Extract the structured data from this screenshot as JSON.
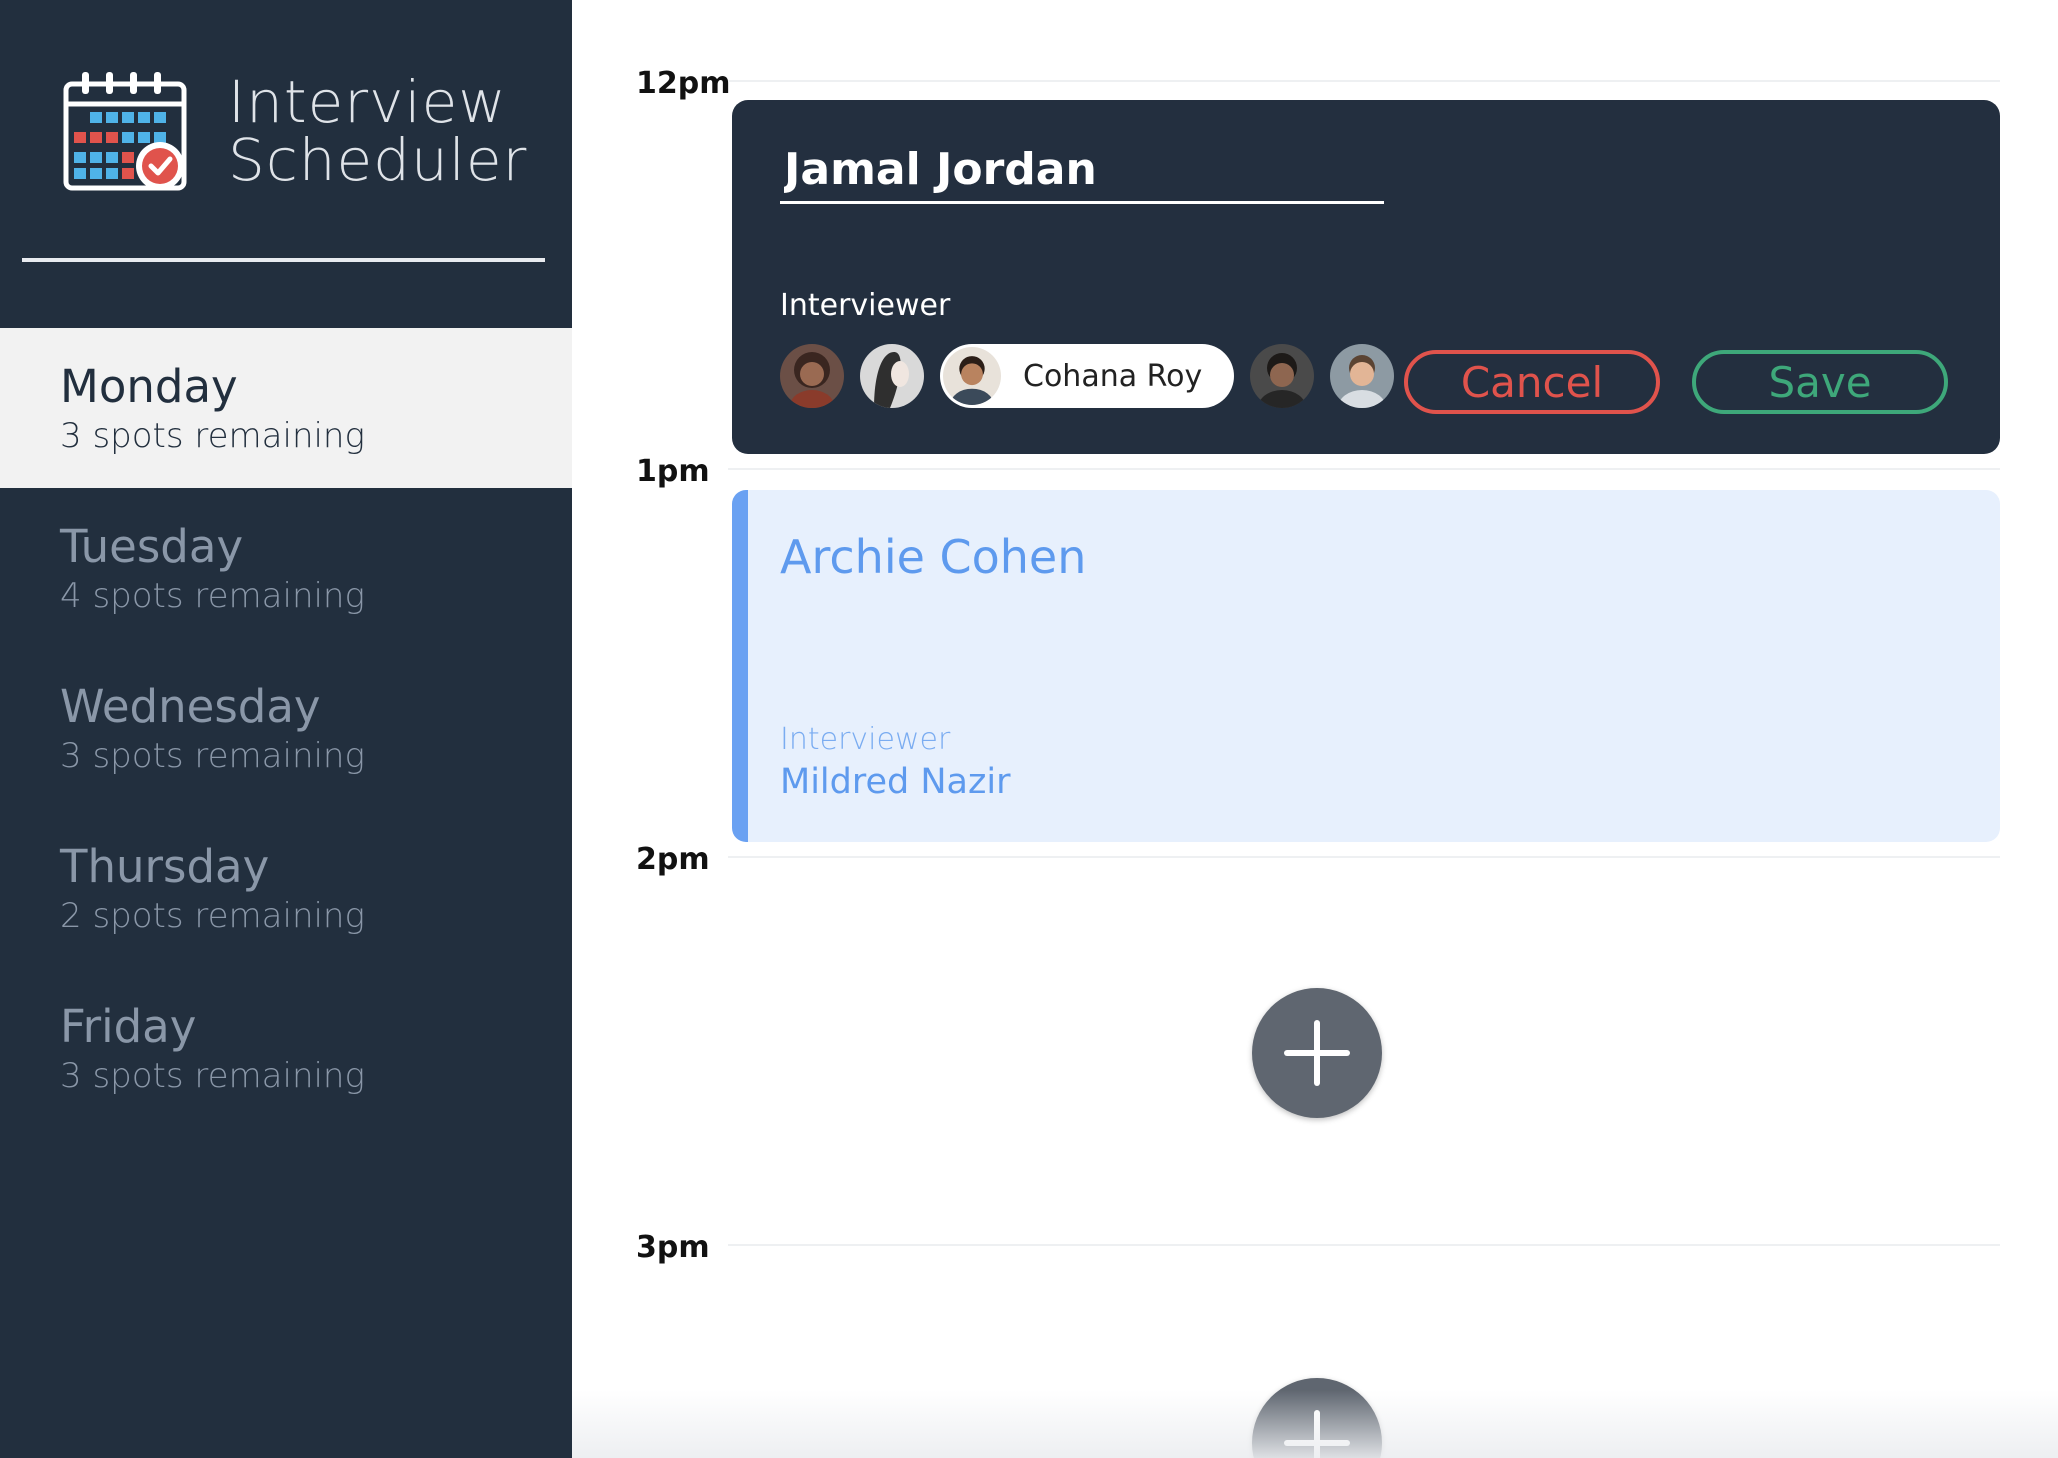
{
  "app": {
    "title_line1": "Interview",
    "title_line2": "Scheduler"
  },
  "days": [
    {
      "name": "Monday",
      "spots": "3 spots remaining",
      "selected": true
    },
    {
      "name": "Tuesday",
      "spots": "4 spots remaining",
      "selected": false
    },
    {
      "name": "Wednesday",
      "spots": "3 spots remaining",
      "selected": false
    },
    {
      "name": "Thursday",
      "spots": "2 spots remaining",
      "selected": false
    },
    {
      "name": "Friday",
      "spots": "3 spots remaining",
      "selected": false
    }
  ],
  "schedule": {
    "hours": [
      "12pm",
      "1pm",
      "2pm",
      "3pm"
    ],
    "edit_form": {
      "student_name": "Jamal Jordan",
      "interviewer_caption": "Interviewer",
      "selected_interviewer": "Cohana Roy",
      "interviewer_count": 5,
      "cancel_label": "Cancel",
      "save_label": "Save"
    },
    "booked": {
      "student": "Archie Cohen",
      "interviewer_caption": "Interviewer",
      "interviewer": "Mildred Nazir"
    }
  },
  "colors": {
    "sidebar": "#222f3e",
    "cancel": "#e0534c",
    "save": "#3ea87a",
    "booked_accent": "#6aa1f2",
    "add_button": "#5f6670"
  },
  "icons": {
    "logo": "calendar-check-icon",
    "add": "plus-icon"
  }
}
